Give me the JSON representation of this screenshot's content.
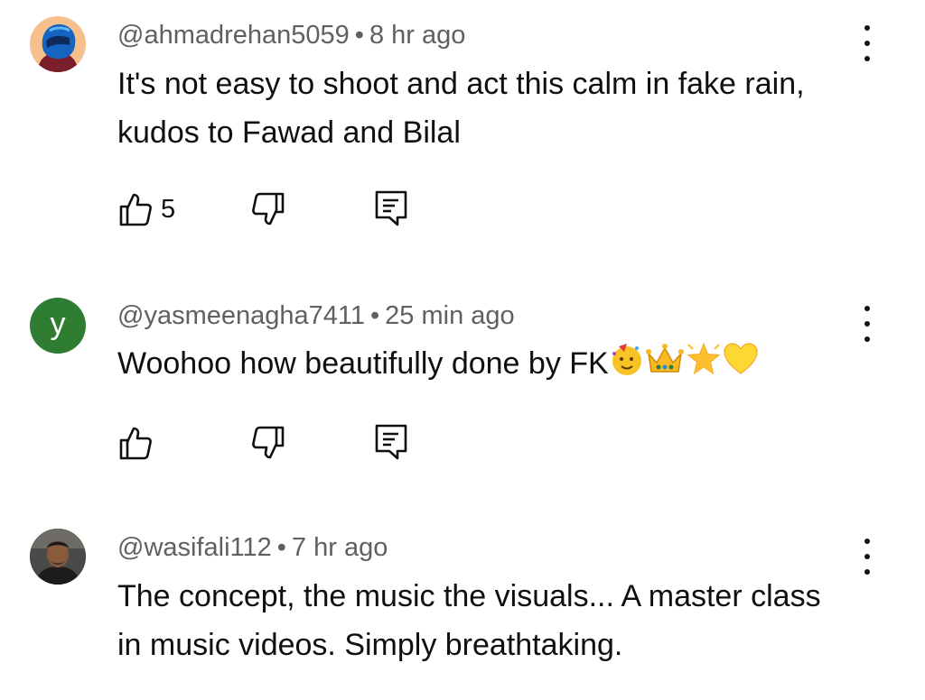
{
  "comments": [
    {
      "handle": "@ahmadrehan5059",
      "separator": "•",
      "time": "8 hr ago",
      "text": "It's not easy to shoot and act this calm in fake rain, kudos to Fawad and Bilal",
      "like_count": "5",
      "avatar_icon": "helmet-avatar-icon",
      "avatar_bg": "#f5c08b"
    },
    {
      "handle": "@yasmeenagha7411",
      "separator": "•",
      "time": "25 min ago",
      "text": "Woohoo how beautifully done by FK",
      "emojis": [
        "partying-face-icon",
        "crown-icon",
        "glowing-star-icon",
        "yellow-heart-icon"
      ],
      "like_count": "",
      "avatar_letter": "y",
      "avatar_bg": "#2e7d32"
    },
    {
      "handle": "@wasifali112",
      "separator": "•",
      "time": "7 hr ago",
      "text": "The concept, the music the visuals... A master class in music videos. Simply breathtaking.",
      "like_count": "",
      "avatar_icon": "photo-avatar-icon",
      "avatar_bg": "#3a3a3a"
    }
  ],
  "icons": {
    "like": "thumbs-up-icon",
    "dislike": "thumbs-down-icon",
    "reply": "reply-icon",
    "more": "more-vert-icon"
  }
}
